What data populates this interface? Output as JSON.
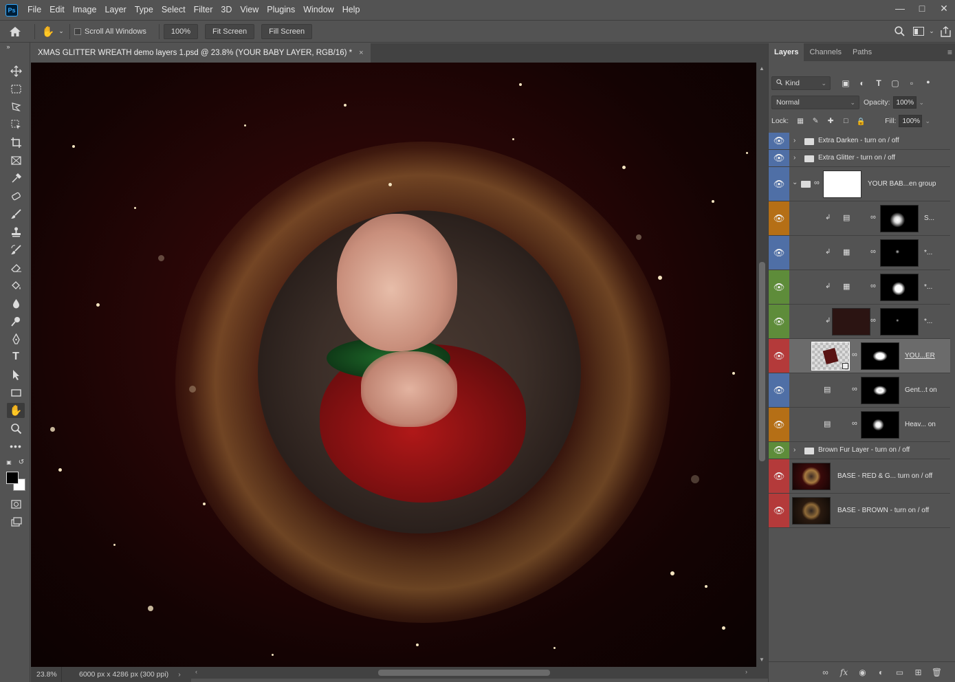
{
  "menubar": {
    "logo": "Ps",
    "items": [
      "File",
      "Edit",
      "Image",
      "Layer",
      "Type",
      "Select",
      "Filter",
      "3D",
      "View",
      "Plugins",
      "Window",
      "Help"
    ],
    "controls": [
      "minimize-icon",
      "maximize-icon",
      "close-icon"
    ]
  },
  "options": {
    "scroll_all_label": "Scroll All Windows",
    "zoom_btn": "100%",
    "fit_btn": "Fit Screen",
    "fill_btn": "Fill Screen"
  },
  "document": {
    "tab_title": "XMAS GLITTER WREATH demo layers 1.psd @ 23.8% (YOUR BABY LAYER, RGB/16) *",
    "close": "×"
  },
  "status": {
    "zoom": "23.8%",
    "info": "6000 px x 4286 px (300 ppi)",
    "arrow": "›"
  },
  "panel": {
    "tabs": [
      "Layers",
      "Channels",
      "Paths"
    ],
    "kind_label": "Kind",
    "blend_mode": "Normal",
    "opacity_label": "Opacity:",
    "opacity_value": "100%",
    "lock_label": "Lock:",
    "fill_label": "Fill:",
    "fill_value": "100%"
  },
  "layers": [
    {
      "name": "Extra Darken - turn on / off",
      "color": "#4f6fa6",
      "type": "group-collapsed"
    },
    {
      "name": "Extra Glitter - turn on / off",
      "color": "#4f6fa6",
      "type": "group-collapsed"
    },
    {
      "name": "YOUR BAB...en group",
      "color": "#4f6fa6",
      "type": "group-open"
    },
    {
      "name": "S...",
      "color": "#b56f16",
      "type": "levels-clipped"
    },
    {
      "name": "*...",
      "color": "#4f6fa6",
      "type": "curves-clipped"
    },
    {
      "name": "*...",
      "color": "#5e8c3a",
      "type": "curves-clipped"
    },
    {
      "name": "*...",
      "color": "#5e8c3a",
      "type": "fill-clipped"
    },
    {
      "name": "YOU...ER",
      "color": "#b43a3a",
      "type": "smart"
    },
    {
      "name": "Gent...t on",
      "color": "#4f6fa6",
      "type": "levels"
    },
    {
      "name": "Heav... on",
      "color": "#b56f16",
      "type": "levels"
    },
    {
      "name": "Brown Fur Layer - turn on / off",
      "color": "#5e8c3a",
      "type": "group-collapsed"
    },
    {
      "name": "BASE - RED & G... turn on / off",
      "color": "#b43a3a",
      "type": "image"
    },
    {
      "name": "BASE - BROWN - turn on / off",
      "color": "#b43a3a",
      "type": "image"
    }
  ]
}
